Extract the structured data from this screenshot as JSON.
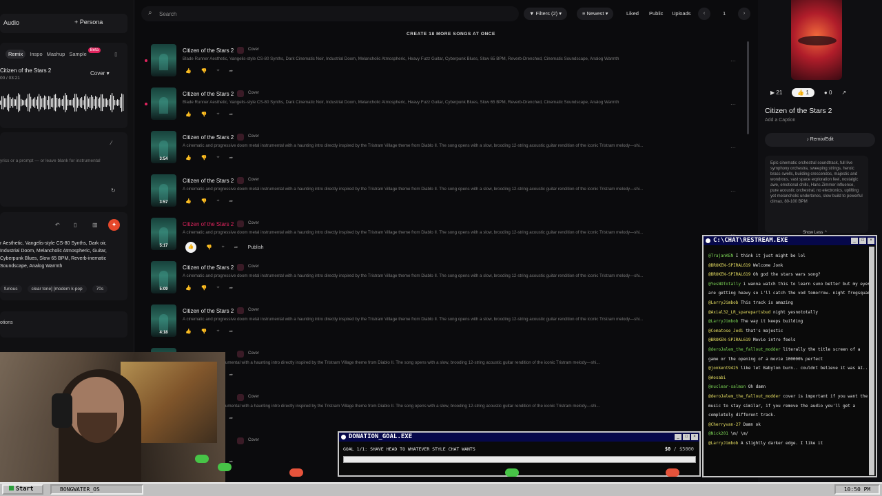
{
  "left_panel": {
    "audio_label": "Audio",
    "persona_label": "Persona",
    "tabs": [
      "Remix",
      "Inspo",
      "Mashup",
      "Sample"
    ],
    "beta_badge": "Beta",
    "song_title": "Citizen of the Stars 2",
    "time": "00 / 03:21",
    "cover_label": "Cover",
    "prompt_placeholder": "yrics or a prompt — or leave blank for instrumental",
    "styles_text": "r Aesthetic, Vangelis-style CS-80 Synths, Dark oir, Industrial Doom, Melancholic Atmospheric, Guitar, Cyberpunk Blues, Slow 65 BPM, Reverb-inematic Soundscape, Analog Warmth",
    "tags": [
      "furious",
      "clear tone] [modern k-pop",
      "70s"
    ],
    "options_label": "otions"
  },
  "topbar": {
    "search_placeholder": "Search",
    "filters_label": "Filters (2)",
    "sort_label": "Newest",
    "liked_label": "Liked",
    "public_label": "Public",
    "uploads_label": "Uploads",
    "page": "1"
  },
  "create_more": "CREATE 18 MORE SONGS AT ONCE",
  "songs": [
    {
      "title": "Citizen of the Stars 2",
      "cover": "Cover",
      "desc": "Blade Runner Aesthetic, Vangelis-style CS-80 Synths, Dark Cinematic Noir, Industrial Doom, Melancholic Atmospheric, Heavy Fuzz Guitar, Cyberpunk Blues, Slow 65 BPM, Reverb-Drenched, Cinematic Soundscape, Analog Warmth",
      "duration": ""
    },
    {
      "title": "Citizen of the Stars 2",
      "cover": "Cover",
      "desc": "Blade Runner Aesthetic, Vangelis-style CS-80 Synths, Dark Cinematic Noir, Industrial Doom, Melancholic Atmospheric, Heavy Fuzz Guitar, Cyberpunk Blues, Slow 65 BPM, Reverb-Drenched, Cinematic Soundscape, Analog Warmth",
      "duration": ""
    },
    {
      "title": "Citizen of the Stars 2",
      "cover": "Cover",
      "desc": "A cinematic and progressive doom metal instrumental with a haunting intro directly inspired by the Tristram Village theme from Diablo II. The song opens with a slow, brooding 12-string acoustic guitar rendition of the iconic Tristram melody—shi...",
      "duration": "3:54"
    },
    {
      "title": "Citizen of the Stars 2",
      "cover": "Cover",
      "desc": "A cinematic and progressive doom metal instrumental with a haunting intro directly inspired by the Tristram Village theme from Diablo II. The song opens with a slow, brooding 12-string acoustic guitar rendition of the iconic Tristram melody—shi...",
      "duration": "3:57"
    },
    {
      "title": "Citizen of the Stars 2",
      "cover": "Cover",
      "desc": "A cinematic and progressive doom metal instrumental with a haunting intro directly inspired by the Tristram Village theme from Diablo II. The song opens with a slow, brooding 12-string acoustic guitar rendition of the iconic Tristram melody—shi...",
      "duration": "5:17",
      "publish": "Publish"
    },
    {
      "title": "Citizen of the Stars 2",
      "cover": "Cover",
      "desc": "A cinematic and progressive doom metal instrumental with a haunting intro directly inspired by the Tristram Village theme from Diablo II. The song opens with a slow, brooding 12-string acoustic guitar rendition of the iconic Tristram melody—shi...",
      "duration": "5:09"
    },
    {
      "title": "Citizen of the Stars 2",
      "cover": "Cover",
      "desc": "A cinematic and progressive doom metal instrumental with a haunting intro directly inspired by the Tristram Village theme from Diablo II. The song opens with a slow, brooding 12-string acoustic guitar rendition of the iconic Tristram melody—shi...",
      "duration": "4:18"
    },
    {
      "title": "s 2",
      "cover": "Cover",
      "desc": "ocive doom metal instrumental with a haunting intro directly inspired by the Tristram Village theme from Diablo II. The song opens with a slow, brooding 12-string acoustic guitar rendition of the iconic Tristram melody—shi...",
      "duration": ""
    },
    {
      "title": "s 2",
      "cover": "Cover",
      "desc": "ocive doom metal instrumental with a haunting intro directly inspired by the Tristram Village theme from Diablo II. The song opens with a slow, brooding 12-string acoustic guitar rendition of the iconic Tristram melody—shi...",
      "duration": ""
    },
    {
      "title": "s 2",
      "cover": "Cover",
      "desc": "",
      "duration": ""
    }
  ],
  "right_panel": {
    "plays": "21",
    "likes": "1",
    "comments": "0",
    "title": "Citizen of the Stars 2",
    "caption": "Add a Caption",
    "remix": "Remix/Edit",
    "description": "Epic cinematic orchestral soundtrack, full live symphony orchestra, sweeping strings, heroic brass swells, building crescendos, majestic and wondrous, vast space exploration feel, nostalgic awe, emotional chills, Hans Zimmer influence, pure acoustic orchestral, no electronics, uplifting yet melancholic undertones, slow build to powerful climax, 80-100 BPM",
    "show_less": "Show Less"
  },
  "chat": {
    "title": "C:\\CHAT\\RESTREAM.EXE",
    "messages": [
      {
        "user": "@TrajanKEN",
        "text": "I think it just might be lol"
      },
      {
        "user": "@BROKEN-SPIRAL619",
        "text": "Welcome Jonk"
      },
      {
        "user": "@BROKEN-SPIRAL619",
        "text": "Oh god the stars wars song?"
      },
      {
        "user": "@YesNOTotally",
        "text": "i wanna watch this to learn suno better but my eyes are getting heavy so i'll catch the vod tomorrow. night frogsquad"
      },
      {
        "user": "@LarryJimbob",
        "text": "This track is amazing"
      },
      {
        "user": "@Axial32_LR_sparepartsbud",
        "text": "night yesnototally"
      },
      {
        "user": "@LarryJimbob",
        "text": "The way it keeps building"
      },
      {
        "user": "@Comatose_Jedi",
        "text": "that's majestic"
      },
      {
        "user": "@BROKEN-SPIRAL619",
        "text": "Movie intro feels"
      },
      {
        "user": "@deroJalem_the_fallout_modder",
        "text": "literally the title screen of a game or the opening of a movie 100000% perfect"
      },
      {
        "user": "@jonkent9425",
        "text": "like let Babylon burn.. couldnt believe it was AI.."
      },
      {
        "user": "@Aosabi",
        "text": ""
      },
      {
        "user": "@nuclear-salmon",
        "text": "Oh damn"
      },
      {
        "user": "@deroJalem_the_fallout_modder",
        "text": "cover is important if you want the music to stay similar, if you remove the audio you'll get a completely different track."
      },
      {
        "user": "@Cherryvan-27",
        "text": "Damn ok"
      },
      {
        "user": "@Nick201",
        "text": "\\m/ \\m/"
      },
      {
        "user": "@LarryJimbob",
        "text": "A slightly darker edge. I like it"
      }
    ]
  },
  "donation": {
    "title": "DONATION_GOAL.EXE",
    "goal": "GOAL 1/1: SHAVE HEAD TO WHATEVER STYLE CHAT WANTS",
    "current": "$0",
    "target": "$5000",
    "progress": 0
  },
  "taskbar": {
    "start": "Start",
    "task": "BONGWATER_OS",
    "clock": "10:50 PM"
  }
}
